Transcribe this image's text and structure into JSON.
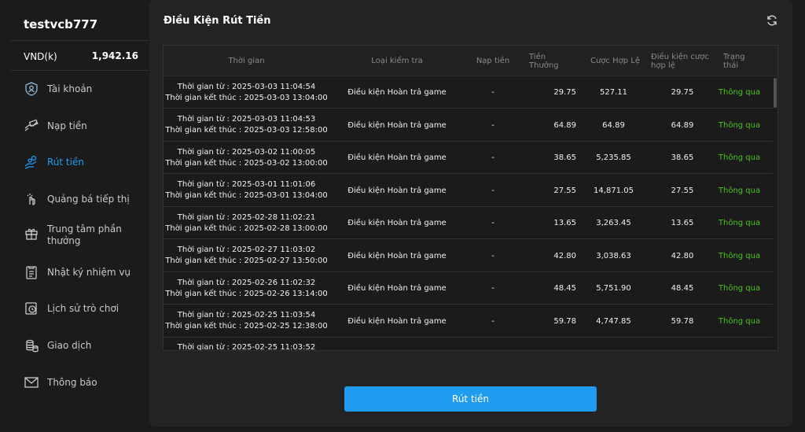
{
  "user": {
    "name": "testvcb777",
    "currency": "VND(k)",
    "balance": "1,942.16"
  },
  "nav": [
    {
      "label": "Tài khoản",
      "active": false
    },
    {
      "label": "Nạp tiền",
      "active": false
    },
    {
      "label": "Rút tiền",
      "active": true
    },
    {
      "label": "Quảng bá tiếp thị",
      "active": false
    },
    {
      "label": "Trung tâm phần thưởng",
      "active": false
    },
    {
      "label": "Nhật ký nhiệm vụ",
      "active": false
    },
    {
      "label": "Lịch sử trò chơi",
      "active": false
    },
    {
      "label": "Giao dịch",
      "active": false
    },
    {
      "label": "Thông báo",
      "active": false
    }
  ],
  "panel": {
    "title": "Điều Kiện Rút Tiền",
    "button": "Rút tiền",
    "columns": [
      "Thời gian",
      "Loại kiểm tra",
      "Nạp tiền",
      "Tiền Thưởng",
      "Cược Hợp Lệ",
      "Điều kiện cược hợp lệ",
      "Trạng thái"
    ],
    "rows": [
      {
        "from": "Thời gian từ : 2025-03-03 11:04:54",
        "to": "Thời gian kết thúc : 2025-03-03 13:04:00",
        "type": "Điều kiện Hoàn trả game",
        "deposit": "-",
        "bonus": "29.75",
        "bet": "527.11",
        "cond": "29.75",
        "status": "Thông qua"
      },
      {
        "from": "Thời gian từ : 2025-03-03 11:04:53",
        "to": "Thời gian kết thúc : 2025-03-03 12:58:00",
        "type": "Điều kiện Hoàn trả game",
        "deposit": "-",
        "bonus": "64.89",
        "bet": "64.89",
        "cond": "64.89",
        "status": "Thông qua"
      },
      {
        "from": "Thời gian từ : 2025-03-02 11:00:05",
        "to": "Thời gian kết thúc : 2025-03-02 13:00:00",
        "type": "Điều kiện Hoàn trả game",
        "deposit": "-",
        "bonus": "38.65",
        "bet": "5,235.85",
        "cond": "38.65",
        "status": "Thông qua"
      },
      {
        "from": "Thời gian từ : 2025-03-01 11:01:06",
        "to": "Thời gian kết thúc : 2025-03-01 13:04:00",
        "type": "Điều kiện Hoàn trả game",
        "deposit": "-",
        "bonus": "27.55",
        "bet": "14,871.05",
        "cond": "27.55",
        "status": "Thông qua"
      },
      {
        "from": "Thời gian từ : 2025-02-28 11:02:21",
        "to": "Thời gian kết thúc : 2025-02-28 13:00:00",
        "type": "Điều kiện Hoàn trả game",
        "deposit": "-",
        "bonus": "13.65",
        "bet": "3,263.45",
        "cond": "13.65",
        "status": "Thông qua"
      },
      {
        "from": "Thời gian từ : 2025-02-27 11:03:02",
        "to": "Thời gian kết thúc : 2025-02-27 13:50:00",
        "type": "Điều kiện Hoàn trả game",
        "deposit": "-",
        "bonus": "42.80",
        "bet": "3,038.63",
        "cond": "42.80",
        "status": "Thông qua"
      },
      {
        "from": "Thời gian từ : 2025-02-26 11:02:32",
        "to": "Thời gian kết thúc : 2025-02-26 13:14:00",
        "type": "Điều kiện Hoàn trả game",
        "deposit": "-",
        "bonus": "48.45",
        "bet": "5,751.90",
        "cond": "48.45",
        "status": "Thông qua"
      },
      {
        "from": "Thời gian từ : 2025-02-25 11:03:54",
        "to": "Thời gian kết thúc : 2025-02-25 12:38:00",
        "type": "Điều kiện Hoàn trả game",
        "deposit": "-",
        "bonus": "59.78",
        "bet": "4,747.85",
        "cond": "59.78",
        "status": "Thông qua"
      },
      {
        "from": "Thời gian từ : 2025-02-25 11:03:52",
        "to": "",
        "type": "",
        "deposit": "",
        "bonus": "",
        "bet": "",
        "cond": "",
        "status": ""
      }
    ]
  },
  "colors": {
    "accent": "#1f9bf0",
    "ok": "#49c21e",
    "panel": "#232325",
    "table": "#1b1b1c"
  }
}
